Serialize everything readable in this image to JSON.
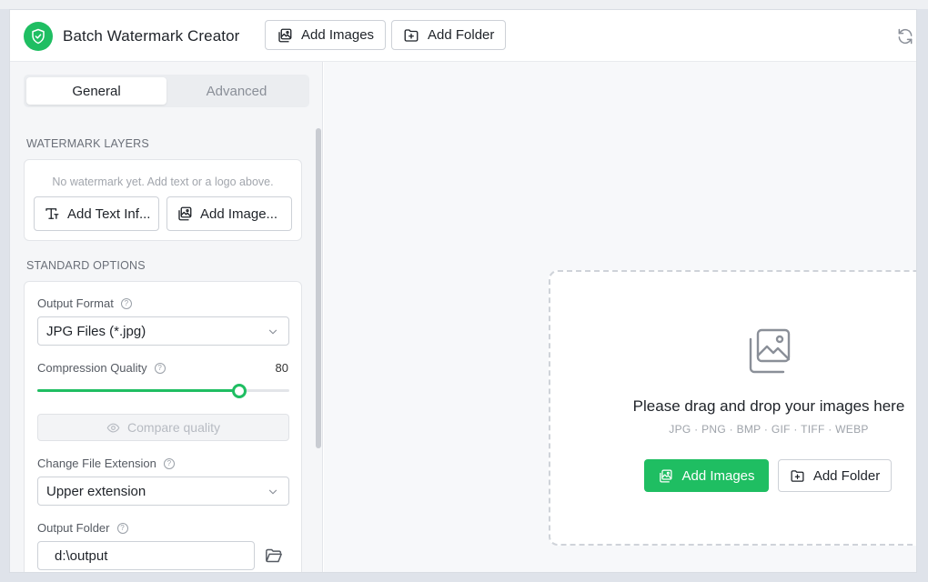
{
  "app": {
    "title": "Batch Watermark Creator",
    "logo_icon": "shield-check-icon",
    "accent_color": "#1fbe62"
  },
  "toolbar": {
    "add_images_label": "Add Images",
    "add_folder_label": "Add Folder",
    "refresh_icon": "refresh-icon"
  },
  "sidebar": {
    "tabs": [
      {
        "label": "General",
        "active": true
      },
      {
        "label": "Advanced",
        "active": false
      }
    ],
    "watermark_layers": {
      "section_title": "WATERMARK LAYERS",
      "empty_hint": "No watermark yet. Add text or a logo above.",
      "add_text_label": "Add Text Inf...",
      "add_image_label": "Add Image..."
    },
    "standard_options": {
      "section_title": "STANDARD OPTIONS",
      "output_format": {
        "label": "Output Format",
        "value": "JPG Files (*.jpg)"
      },
      "compression_quality": {
        "label": "Compression Quality",
        "value": "80",
        "percent": 80
      },
      "compare_quality_label": "Compare quality",
      "change_file_extension": {
        "label": "Change File Extension",
        "value": "Upper extension"
      },
      "output_folder": {
        "label": "Output Folder",
        "value": "d:\\output"
      }
    }
  },
  "dropzone": {
    "title": "Please drag and drop your images here",
    "formats": "JPG · PNG · BMP · GIF · TIFF · WEBP",
    "add_images_label": "Add Images",
    "add_folder_label": "Add Folder"
  }
}
